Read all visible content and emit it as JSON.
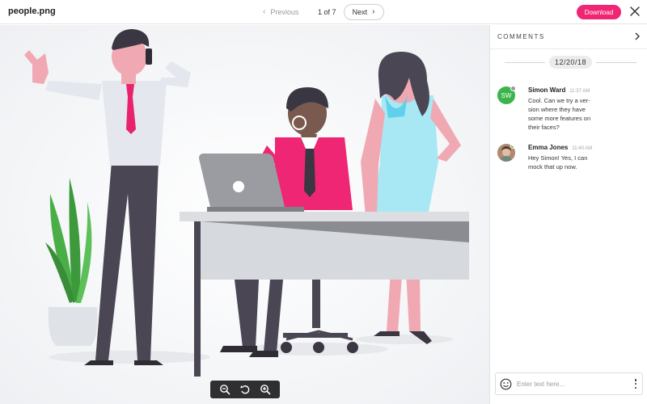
{
  "header": {
    "filename": "people.png",
    "prev_label": "Previous",
    "counter": "1 of 7",
    "next_label": "Next",
    "download_label": "Download"
  },
  "icons": {
    "prev": "chevron-left-icon",
    "next": "chevron-right-icon",
    "close": "close-icon",
    "zoom_out": "zoom-out-icon",
    "rotate": "rotate-icon",
    "zoom_in": "zoom-in-icon",
    "collapse": "chevron-right-icon",
    "emoji": "emoji-icon",
    "more": "more-vertical-icon"
  },
  "colors": {
    "accent": "#ef2673",
    "online": "#39b54a",
    "away": "#9b9b9b"
  },
  "comments_panel": {
    "title": "COMMENTS",
    "date": "12/20/18",
    "items": [
      {
        "author": "Simon Ward",
        "initials": "SW",
        "time": "11:37 AM",
        "lines": [
          "Cool. Can we try a ver-",
          "sion where they have",
          "some more features on",
          "their faces?"
        ]
      },
      {
        "author": "Emma Jones",
        "time": "11:40 AM",
        "lines": [
          "Hey Simon! Yes, I can",
          "mock that up now."
        ]
      }
    ],
    "composer_placeholder": "Enter text here..."
  }
}
